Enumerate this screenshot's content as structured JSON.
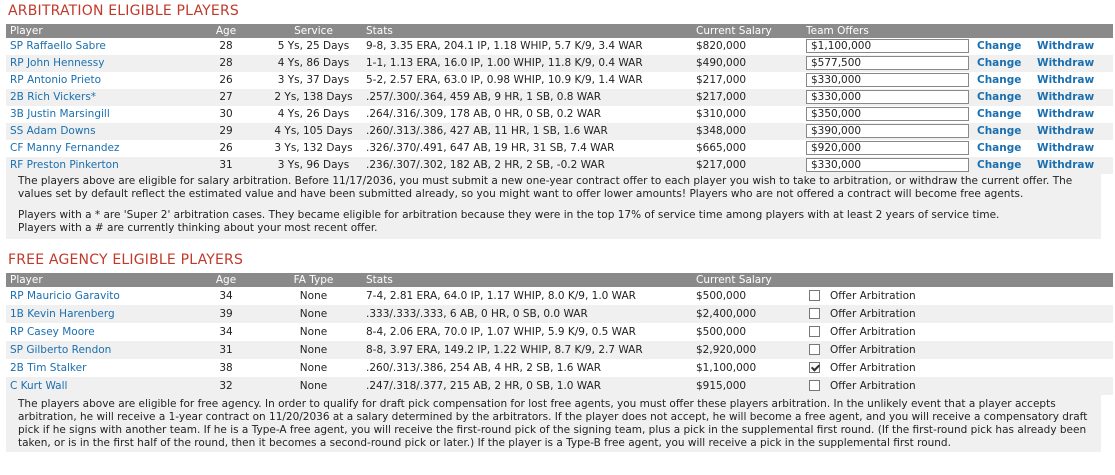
{
  "arbitration": {
    "title": "ARBITRATION ELIGIBLE PLAYERS",
    "headers": {
      "player": "Player",
      "age": "Age",
      "service": "Service",
      "stats": "Stats",
      "salary": "Current Salary",
      "offers": "Team Offers"
    },
    "change_label": "Change",
    "withdraw_label": "Withdraw",
    "rows": [
      {
        "player": "SP Raffaello Sabre",
        "age": "28",
        "service": "5 Ys, 25 Days",
        "stats": "9-8, 3.35 ERA, 204.1 IP, 1.18 WHIP, 5.7 K/9, 3.4 WAR",
        "salary": "$820,000",
        "offer": "$1,100,000"
      },
      {
        "player": "RP John Hennessy",
        "age": "28",
        "service": "4 Ys, 86 Days",
        "stats": "1-1, 1.13 ERA, 16.0 IP, 1.00 WHIP, 11.8 K/9, 0.4 WAR",
        "salary": "$490,000",
        "offer": "$577,500"
      },
      {
        "player": "RP Antonio Prieto",
        "age": "26",
        "service": "3 Ys, 37 Days",
        "stats": "5-2, 2.57 ERA, 63.0 IP, 0.98 WHIP, 10.9 K/9, 1.4 WAR",
        "salary": "$217,000",
        "offer": "$330,000"
      },
      {
        "player": "2B Rich Vickers*",
        "age": "27",
        "service": "2 Ys, 138 Days",
        "stats": ".257/.300/.364, 459 AB, 9 HR, 1 SB, 0.8 WAR",
        "salary": "$217,000",
        "offer": "$330,000"
      },
      {
        "player": "3B Justin Marsingill",
        "age": "30",
        "service": "4 Ys, 26 Days",
        "stats": ".264/.316/.309, 178 AB, 0 HR, 0 SB, 0.2 WAR",
        "salary": "$310,000",
        "offer": "$350,000"
      },
      {
        "player": "SS Adam Downs",
        "age": "29",
        "service": "4 Ys, 105 Days",
        "stats": ".260/.313/.386, 427 AB, 11 HR, 1 SB, 1.6 WAR",
        "salary": "$348,000",
        "offer": "$390,000"
      },
      {
        "player": "CF Manny Fernandez",
        "age": "26",
        "service": "3 Ys, 132 Days",
        "stats": ".326/.370/.491, 647 AB, 19 HR, 31 SB, 7.4 WAR",
        "salary": "$665,000",
        "offer": "$920,000"
      },
      {
        "player": "RF Preston Pinkerton",
        "age": "31",
        "service": "3 Ys, 96 Days",
        "stats": ".236/.307/.302, 182 AB, 2 HR, 2 SB, -0.2 WAR",
        "salary": "$217,000",
        "offer": "$330,000"
      }
    ],
    "note1": "The players above are eligible for salary arbitration. Before 11/17/2036, you must submit a new one-year contract offer to each player you wish to take to arbitration, or withdraw the current offer. The values set by default reflect the estimated value and have been submitted already, so you might want to offer lower amounts! Players who are not offered a contract will become free agents.",
    "note2": "Players with a * are 'Super 2' arbitration cases. They became eligible for arbitration because they were in the top 17% of service time among players with at least 2 years of service time.",
    "note3": "Players with a # are currently thinking about your most recent offer."
  },
  "free_agency": {
    "title": "FREE AGENCY ELIGIBLE PLAYERS",
    "headers": {
      "player": "Player",
      "age": "Age",
      "fa_type": "FA Type",
      "stats": "Stats",
      "salary": "Current Salary"
    },
    "offer_label": "Offer Arbitration",
    "rows": [
      {
        "player": "RP Mauricio Garavito",
        "age": "34",
        "fa_type": "None",
        "stats": "7-4, 2.81 ERA, 64.0 IP, 1.17 WHIP, 8.0 K/9, 1.0 WAR",
        "salary": "$500,000",
        "checked": false
      },
      {
        "player": "1B Kevin Harenberg",
        "age": "39",
        "fa_type": "None",
        "stats": ".333/.333/.333, 6 AB, 0 HR, 0 SB, 0.0 WAR",
        "salary": "$2,400,000",
        "checked": false
      },
      {
        "player": "RP Casey Moore",
        "age": "34",
        "fa_type": "None",
        "stats": "8-4, 2.06 ERA, 70.0 IP, 1.07 WHIP, 5.9 K/9, 0.5 WAR",
        "salary": "$500,000",
        "checked": false
      },
      {
        "player": "SP Gilberto Rendon",
        "age": "31",
        "fa_type": "None",
        "stats": "8-8, 3.97 ERA, 149.2 IP, 1.22 WHIP, 8.7 K/9, 2.7 WAR",
        "salary": "$2,920,000",
        "checked": false
      },
      {
        "player": "2B Tim Stalker",
        "age": "38",
        "fa_type": "None",
        "stats": ".260/.313/.386, 254 AB, 4 HR, 2 SB, 1.6 WAR",
        "salary": "$1,100,000",
        "checked": true
      },
      {
        "player": "C Kurt Wall",
        "age": "32",
        "fa_type": "None",
        "stats": ".247/.318/.377, 215 AB, 2 HR, 0 SB, 1.0 WAR",
        "salary": "$915,000",
        "checked": false
      }
    ],
    "note": "The players above are eligible for free agency. In order to qualify for draft pick compensation for lost free agents, you must offer these players arbitration. In the unlikely event that a player accepts arbitration, he will receive a 1-year contract on 11/20/2036 at a salary determined by the arbitrators. If the player does not accept, he will become a free agent, and you will receive a compensatory draft pick if he signs with another team. If he is a Type-A free agent, you will receive the first-round pick of the signing team, plus a pick in the supplemental first round. (If the first-round pick has already been taken, or is in the first half of the round, then it becomes a second-round pick or later.) If the player is a Type-B free agent, you will receive a pick in the supplemental first round."
  }
}
